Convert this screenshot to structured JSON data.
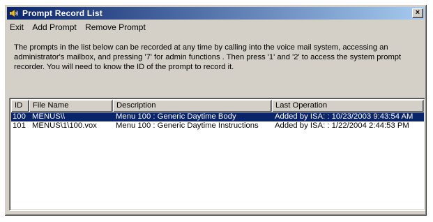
{
  "window": {
    "title": "Prompt Record List",
    "close_glyph": "×",
    "title_icon": "speaker-icon"
  },
  "menu": {
    "items": [
      "Exit",
      "Add Prompt",
      "Remove Prompt"
    ]
  },
  "info_text": "The prompts in the list below can be recorded at any time by calling into the voice mail system, accessing an administrator's mailbox, and pressing '7' for admin functions . Then press '1' and '2' to access the system prompt recorder. You will need to know the ID of the prompt to record it.",
  "list": {
    "columns": [
      "ID",
      "File Name",
      "Description",
      "Last Operation"
    ],
    "rows": [
      {
        "id": "100",
        "file": "MENUS\\\\",
        "description": "Menu 100 : Generic Daytime Body",
        "last_op": "Added by ISA: : 10/23/2003 9:43:54 AM",
        "selected": true
      },
      {
        "id": "101",
        "file": "MENUS\\1\\100.vox",
        "description": "Menu 100 : Generic Daytime Instructions",
        "last_op": "Added by ISA: : 1/22/2004 2:44:53 PM",
        "selected": false
      }
    ]
  },
  "colors": {
    "titlebar_start": "#0a246a",
    "titlebar_end": "#a6caf0",
    "selection": "#0a246a",
    "face": "#d4d0c8"
  }
}
